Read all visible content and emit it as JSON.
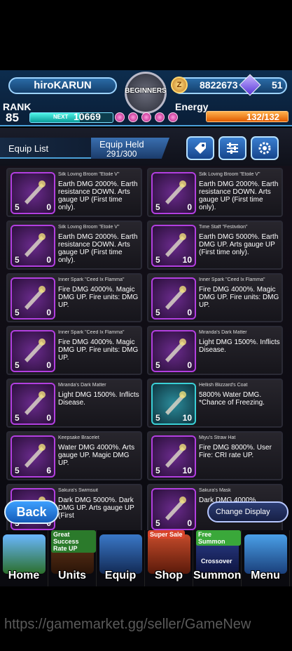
{
  "header": {
    "player_name": "hiroKARUN",
    "emblem_text": "BEGINNERS",
    "gold": "8822673",
    "gems": "51",
    "rank_label": "RANK",
    "rank": "85",
    "next_label": "NEXT",
    "next_value": "10669",
    "next_progress": 0.6,
    "energy_label": "Energy",
    "energy_value": "132/132",
    "energy_fraction": 1.0
  },
  "subheader": {
    "equip_list_label": "Equip List",
    "equip_held_label": "Equip Held",
    "equip_held_value": "291/300",
    "buttons": [
      "tag-icon",
      "filter-icon",
      "gear-icon"
    ]
  },
  "equipment": [
    {
      "title": "Silk Loving Broom \"Etoile V\"",
      "desc": "Earth DMG 2000%. Earth resistance DOWN. Arts gauge UP (First time only).",
      "stars": "5",
      "level": "0",
      "frame": "purple"
    },
    {
      "title": "Silk Loving Broom \"Etoile V\"",
      "desc": "Earth DMG 2000%. Earth resistance DOWN. Arts gauge UP (First time only).",
      "stars": "5",
      "level": "0",
      "frame": "purple"
    },
    {
      "title": "Silk Loving Broom \"Etoile V\"",
      "desc": "Earth DMG 2000%. Earth resistance DOWN. Arts gauge UP (First time only).",
      "stars": "5",
      "level": "0",
      "frame": "purple"
    },
    {
      "title": "Time Staff \"Festivilion\"",
      "desc": "Earth DMG 5000%. Earth DMG UP. Arts gauge UP (First time only).",
      "stars": "5",
      "level": "10",
      "frame": "purple"
    },
    {
      "title": "Inner Spark \"Ceed Ix Flamma\"",
      "desc": "Fire DMG 4000%. Magic DMG UP. Fire units: DMG UP.",
      "stars": "5",
      "level": "0",
      "frame": "purple"
    },
    {
      "title": "Inner Spark \"Ceed Ix Flamma\"",
      "desc": "Fire DMG 4000%. Magic DMG UP. Fire units: DMG UP.",
      "stars": "5",
      "level": "0",
      "frame": "purple"
    },
    {
      "title": "Inner Spark \"Ceed Ix Flamma\"",
      "desc": "Fire DMG 4000%. Magic DMG UP. Fire units: DMG UP.",
      "stars": "5",
      "level": "0",
      "frame": "purple"
    },
    {
      "title": "Miranda's Dark Matter",
      "desc": "Light DMG 1500%. Inflicts Disease.",
      "stars": "5",
      "level": "0",
      "frame": "purple"
    },
    {
      "title": "Miranda's Dark Matter",
      "desc": "Light DMG 1500%. Inflicts Disease.",
      "stars": "5",
      "level": "0",
      "frame": "purple"
    },
    {
      "title": "Hellish Blizzard's Coat",
      "desc": "5800% Water DMG. *Chance of Freezing.",
      "stars": "5",
      "level": "10",
      "frame": "teal"
    },
    {
      "title": "Keepsake Bracelet",
      "desc": "Water DMG 4000%. Arts gauge UP. Magic DMG UP.",
      "stars": "5",
      "level": "6",
      "frame": "purple"
    },
    {
      "title": "Miyu's Straw Hat",
      "desc": "Fire DMG 8000%. User Fire: CRI rate UP.",
      "stars": "5",
      "level": "10",
      "frame": "purple"
    },
    {
      "title": "Sakura's Swimsuit",
      "desc": "Dark DMG 5000%. Dark DMG UP. Arts gauge UP (First",
      "stars": "5",
      "level": "0",
      "frame": "purple"
    },
    {
      "title": "Sakura's Mask",
      "desc": "Dark DMG 4000%.",
      "stars": "5",
      "level": "0",
      "frame": "purple"
    }
  ],
  "actions": {
    "back_label": "Back",
    "change_display_label": "Change Display"
  },
  "nav": [
    {
      "label": "Home",
      "tag": ""
    },
    {
      "label": "Units",
      "tag": "Great Success Rate UP"
    },
    {
      "label": "Equip",
      "tag": ""
    },
    {
      "label": "Shop",
      "tag": "Super Sale"
    },
    {
      "label": "Summon",
      "tag": "Free Summon"
    },
    {
      "label": "Menu",
      "tag": ""
    }
  ],
  "summon_subtag": "Crossover",
  "watermark": "https://gamemarket.gg/seller/GameNew",
  "colors": {
    "accent": "#4aa0d8",
    "energy": "#e05b00",
    "next": "#0a9c9a",
    "frame_purple": "#b23fe0",
    "frame_teal": "#3ad0d6"
  }
}
